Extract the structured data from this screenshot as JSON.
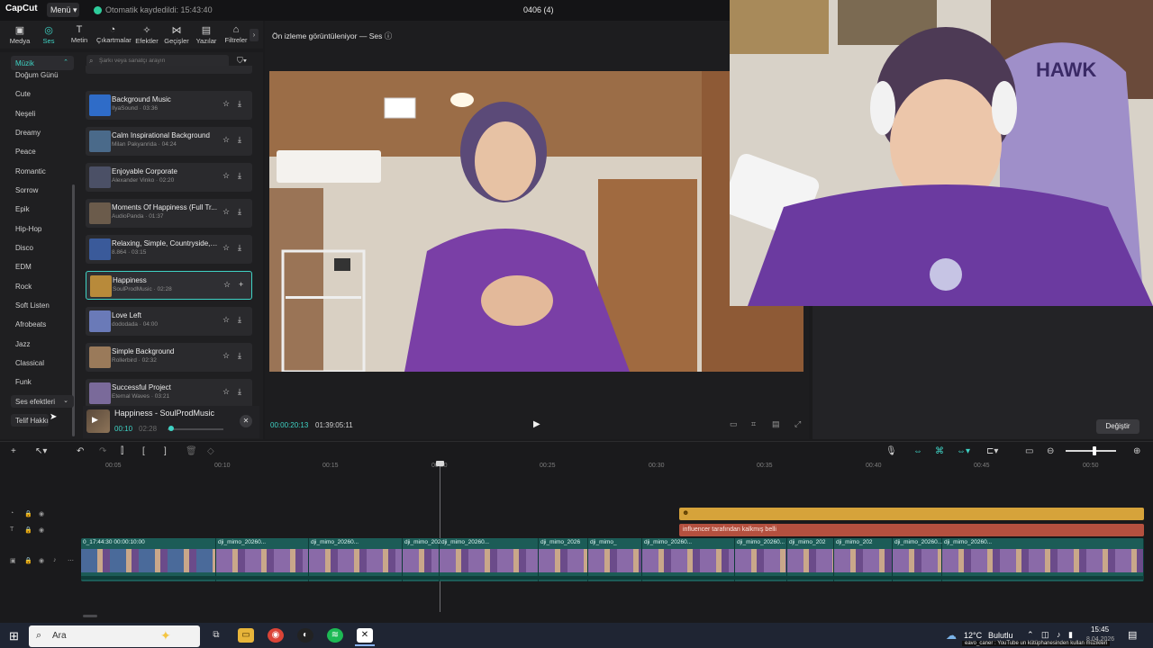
{
  "titlebar": {
    "logo": "CapCut",
    "menu_label": "Menü",
    "autosave": "Otomatik kaydedildi: 15:43:40",
    "project_title": "0406 (4)"
  },
  "tooltabs": [
    {
      "label": "Medya",
      "icon": "▢"
    },
    {
      "label": "Ses",
      "icon": "◎"
    },
    {
      "label": "Metin",
      "icon": "TI"
    },
    {
      "label": "Çıkartmalar",
      "icon": "◔"
    },
    {
      "label": "Efektler",
      "icon": "✧"
    },
    {
      "label": "Geçişler",
      "icon": "⋈"
    },
    {
      "label": "Yazılar",
      "icon": "▤"
    },
    {
      "label": "Filtreler",
      "icon": "⌂"
    }
  ],
  "categories": {
    "active": "Müzik",
    "items": [
      "Doğum Günü",
      "Cute",
      "Neşeli",
      "Dreamy",
      "Peace",
      "Romantic",
      "Sorrow",
      "Epik",
      "Hip-Hop",
      "Disco",
      "EDM",
      "Rock",
      "Soft Listen",
      "Afrobeats",
      "Jazz",
      "Classical",
      "Funk"
    ],
    "sound_effects": "Ses efektleri",
    "copyright": "Telif Hakkı"
  },
  "search": {
    "placeholder": "Şarkı veya sanatçı arayın"
  },
  "tracks": [
    {
      "name": "Background Music",
      "sub": "IlyaSound · 03:36",
      "color": "#2f6cc8"
    },
    {
      "name": "Calm Inspirational Background",
      "sub": "Milan Pakyanrida · 04:24",
      "color": "#4a6a8a"
    },
    {
      "name": "Enjoyable Corporate",
      "sub": "Alexander Vinko · 02:20",
      "color": "#4b5066"
    },
    {
      "name": "Moments Of Happiness (Full Tr...",
      "sub": "AudioPanda · 01:37",
      "color": "#6b5b4b"
    },
    {
      "name": "Relaxing, Simple, Countryside, ...",
      "sub": "8.864 · 03:15",
      "color": "#3a5a9a"
    },
    {
      "name": "Happiness",
      "sub": "SoulProdMusic · 02:28",
      "color": "#b88a3a"
    },
    {
      "name": "Love Left",
      "sub": "dododada · 04:00",
      "color": "#6a7ab8"
    },
    {
      "name": "Simple Background",
      "sub": "Rollerbird · 02:32",
      "color": "#9a7a5a"
    },
    {
      "name": "Successful Project",
      "sub": "Eternal Waves · 03:21",
      "color": "#7a6a9a"
    }
  ],
  "now_playing": {
    "title": "Happiness - SoulProdMusic",
    "current": "00:10",
    "duration": "02:28",
    "progress": 0.07
  },
  "preview": {
    "label": "Ön izleme görüntüleniyor — Ses",
    "time": "00:00:20:13",
    "total": "01:39:05:11"
  },
  "right_panel": {
    "replace_label": "Değiştir"
  },
  "timeline": {
    "ticks": [
      "00:05",
      "00:10",
      "00:15",
      "00:20",
      "00:25",
      "00:30",
      "00:35",
      "00:40",
      "00:45",
      "00:50"
    ],
    "text_clip": "influencer tarafından kalkmış belli",
    "clips": [
      {
        "label": "0_17:44:30",
        "sub": "00:00:10:00"
      },
      {
        "label": "dji_mimo_20260..."
      },
      {
        "label": "dji_mimo_20260..."
      },
      {
        "label": "dji_mimo_202"
      },
      {
        "label": "dji_mimo_20260..."
      },
      {
        "label": "dji_mimo_2026"
      },
      {
        "label": "dji_mimo_"
      },
      {
        "label": "dji_mimo_20260..."
      },
      {
        "label": "dji_mimo_20260..."
      },
      {
        "label": "dji_mimo_202"
      },
      {
        "label": "dji_mimo_202"
      },
      {
        "label": "dji_mimo_20260..."
      },
      {
        "label": "dji_mimo_20260..."
      }
    ]
  },
  "taskbar": {
    "search_placeholder": "Ara",
    "weather_temp": "12°C",
    "weather_desc": "Bulutlu",
    "clock": "15:45",
    "date": "8.04.2026",
    "ticker": "eavo_caner : YouTube un kütüphanesinden kullan müzikleri"
  },
  "colors": {
    "accent": "#3fd3c5",
    "text_clip": "#b4503f",
    "sticker_clip": "#d6a33a",
    "video_track": "#1c5c57"
  }
}
